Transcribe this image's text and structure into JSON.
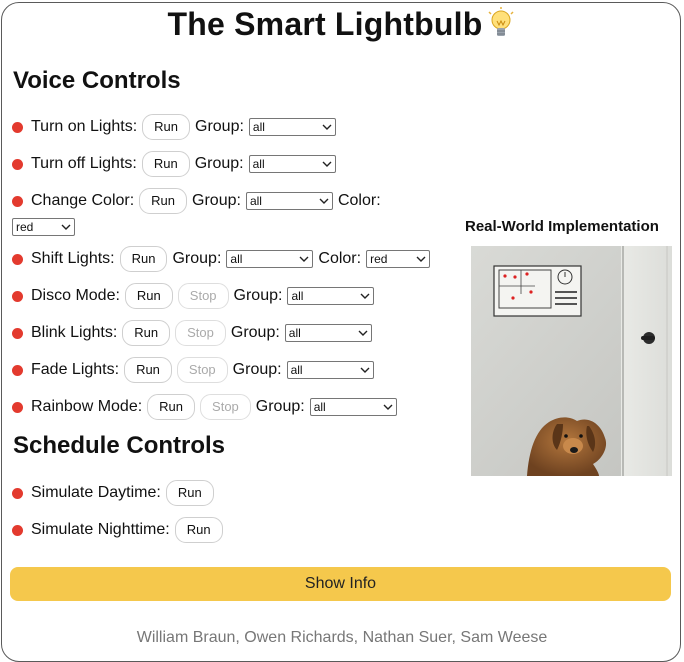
{
  "header": {
    "title": "The Smart Lightbulb",
    "icon": "lightbulb-icon"
  },
  "voice": {
    "heading": "Voice Controls",
    "items": [
      {
        "label": "Turn on Lights:",
        "run": "Run",
        "group_label": "Group:",
        "group_value": "all"
      },
      {
        "label": "Turn off Lights:",
        "run": "Run",
        "group_label": "Group:",
        "group_value": "all"
      },
      {
        "label": "Change Color:",
        "run": "Run",
        "group_label": "Group:",
        "group_value": "all",
        "color_label": "Color:",
        "color_value": "red"
      },
      {
        "label": "Shift Lights:",
        "run": "Run",
        "group_label": "Group:",
        "group_value": "all",
        "color_label": "Color:",
        "color_value": "red"
      },
      {
        "label": "Disco Mode:",
        "run": "Run",
        "stop": "Stop",
        "group_label": "Group:",
        "group_value": "all"
      },
      {
        "label": "Blink Lights:",
        "run": "Run",
        "stop": "Stop",
        "group_label": "Group:",
        "group_value": "all"
      },
      {
        "label": "Fade Lights:",
        "run": "Run",
        "stop": "Stop",
        "group_label": "Group:",
        "group_value": "all"
      },
      {
        "label": "Rainbow Mode:",
        "run": "Run",
        "stop": "Stop",
        "group_label": "Group:",
        "group_value": "all"
      }
    ]
  },
  "schedule": {
    "heading": "Schedule Controls",
    "items": [
      {
        "label": "Simulate Daytime:",
        "run": "Run"
      },
      {
        "label": "Simulate Nighttime:",
        "run": "Run"
      }
    ]
  },
  "real_world": {
    "title": "Real-World Implementation"
  },
  "info_button": "Show Info",
  "footer": "William Braun, Owen Richards, Nathan Suer, Sam Weese",
  "colors": {
    "status_dot": "#e33a2e",
    "info_button": "#f5c84c"
  }
}
